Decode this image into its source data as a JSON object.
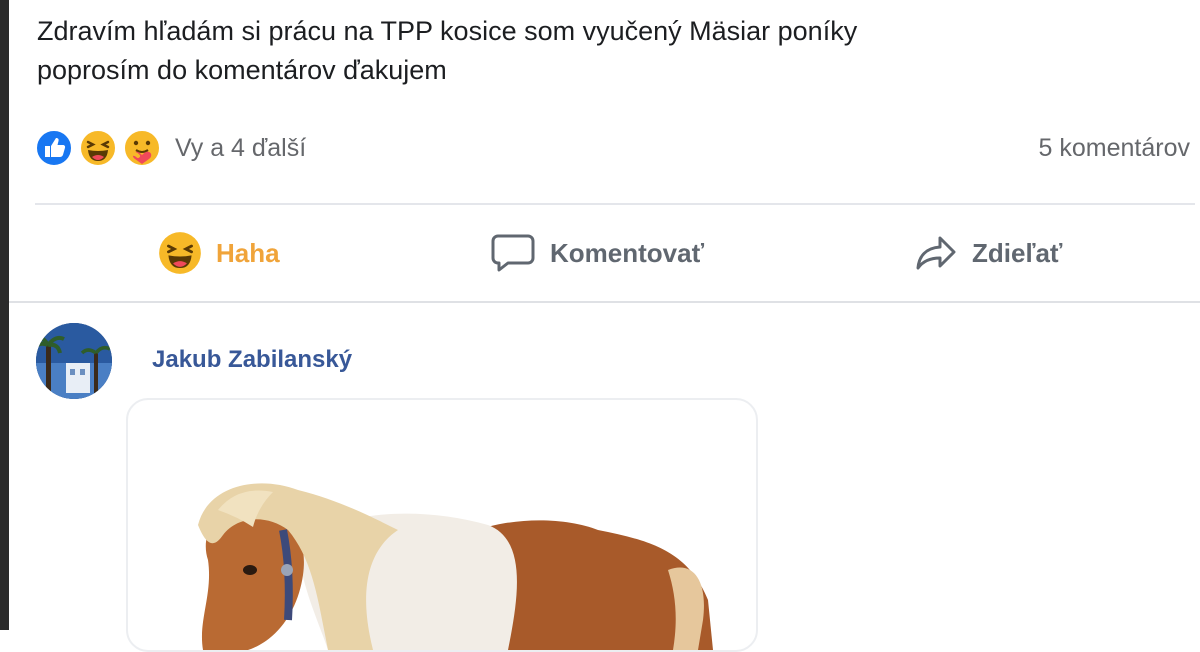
{
  "post": {
    "text_line1": "Zdravím hľadám si prácu na TPP kosice som vyučený Mäsiar poníky",
    "text_line2": "poprosím do komentárov ďakujem"
  },
  "reactions": {
    "icons": [
      "like-icon",
      "haha-icon",
      "care-icon"
    ],
    "summary": "Vy a 4 ďalší",
    "comments_count": "5 komentárov"
  },
  "actions": {
    "haha_label": "Haha",
    "comment_label": "Komentovať",
    "share_label": "Zdieľať"
  },
  "comment": {
    "author": "Jakub Zabilanský",
    "attachment_icon": "pony-image"
  },
  "colors": {
    "like_blue": "#1877f2",
    "haha_yellow": "#f7b928",
    "haha_label": "#f0a43a",
    "name_blue": "#385898",
    "muted_text": "#65676b"
  }
}
